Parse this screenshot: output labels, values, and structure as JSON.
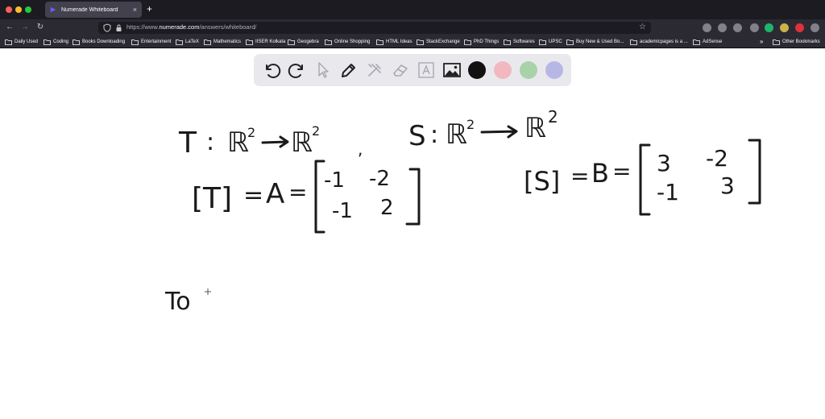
{
  "browser": {
    "tab": {
      "title": "Numerade Whiteboard",
      "close_icon": "×"
    },
    "new_tab_icon": "+",
    "nav": {
      "back_icon": "←",
      "forward_icon": "→",
      "reload_icon": "↻"
    },
    "url": {
      "prefix": "https://www.",
      "domain": "numerade.com",
      "path": "/answers/whiteboard/"
    },
    "star_icon": "☆",
    "extensions": [
      {
        "name": "pocket-icon",
        "color": "#c8c8d0"
      },
      {
        "name": "download-icon",
        "color": "#c8c8d0"
      },
      {
        "name": "screenshot-icon",
        "color": "#c8c8d0"
      },
      {
        "name": "extension-lock-icon",
        "color": "#c8c8d0"
      },
      {
        "name": "extension-green-icon",
        "color": "#1eb56b"
      },
      {
        "name": "extension-yellow-icon",
        "color": "#c9b34a"
      },
      {
        "name": "abp-icon",
        "color": "#e0313b"
      },
      {
        "name": "puzzle-icon",
        "color": "#c8c8d0"
      },
      {
        "name": "account-icon",
        "color": "#c8c8d0"
      },
      {
        "name": "menu-icon",
        "color": "#c8c8d0"
      }
    ],
    "bookmarks": [
      "Daily Used",
      "Coding",
      "Books Downloading",
      "Entertainment",
      "LaTeX",
      "Mathematics",
      "IISER Kolkata",
      "Geogebra",
      "Online Shopping",
      "HTML Ideas",
      "StackExchange",
      "PhD Things",
      "Softwares",
      "UPSC",
      "Buy New & Used Bo...",
      "academicpages is a ...",
      "AdSense"
    ],
    "bookmarks_more_icon": "»",
    "other_bookmarks": "Other Bookmarks"
  },
  "toolbar": {
    "tools": [
      "undo-icon",
      "redo-icon",
      "select-icon",
      "pen-icon",
      "tools-icon",
      "eraser-icon",
      "text-icon",
      "image-icon"
    ],
    "colors": [
      "#111111",
      "#f1b8bf",
      "#a8d2a8",
      "#b7b7e6"
    ],
    "selected_color": "#111111"
  },
  "whiteboard": {
    "line1_left": {
      "name": "T",
      "domain": "ℝ",
      "domain_exp": "2",
      "codomain": "ℝ",
      "codomain_exp": "2"
    },
    "line1_right": {
      "name": "S",
      "domain": "ℝ",
      "domain_exp": "2",
      "codomain": "ℝ",
      "codomain_exp": "2"
    },
    "matrix_t": {
      "lhs": "[T]",
      "name": "A",
      "rows": [
        [
          "-1",
          "-2"
        ],
        [
          "-1",
          "2"
        ]
      ]
    },
    "matrix_s": {
      "lhs": "[S]",
      "name": "B",
      "rows": [
        [
          "3",
          "-2"
        ],
        [
          "-1",
          "3"
        ]
      ]
    },
    "composition": "To",
    "colon": ":",
    "equals": "=",
    "separator": ","
  }
}
